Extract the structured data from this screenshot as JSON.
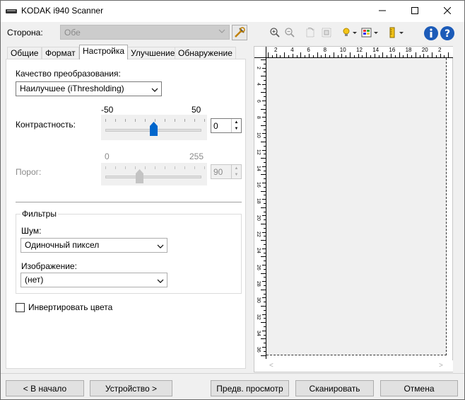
{
  "window": {
    "title": "KODAK i940 Scanner",
    "minimize": "—",
    "maximize": "☐",
    "close": "✕"
  },
  "side": {
    "label": "Сторона:",
    "value": "Обе"
  },
  "tabs": [
    {
      "label": "Общие"
    },
    {
      "label": "Формат"
    },
    {
      "label": "Настройка"
    },
    {
      "label": "Улучшение"
    },
    {
      "label": "Обнаружение"
    }
  ],
  "settings": {
    "conversion_quality_label": "Качество преобразования:",
    "conversion_quality_value": "Наилучшее (iThresholding)",
    "contrast": {
      "label": "Контрастность:",
      "min_label": "-50",
      "max_label": "50",
      "min": -50,
      "max": 50,
      "value": 0,
      "value_text": "0"
    },
    "threshold": {
      "label": "Порог:",
      "min_label": "0",
      "max_label": "255",
      "min": 0,
      "max": 255,
      "value": 90,
      "value_text": "90"
    },
    "filters": {
      "title": "Фильтры",
      "noise_label": "Шум:",
      "noise_value": "Одиночный пиксел",
      "image_label": "Изображение:",
      "image_value": "(нет)"
    },
    "invert_label": "Инвертировать цвета",
    "invert_checked": false
  },
  "ruler": {
    "top_labels": [
      "2",
      "4",
      "6",
      "8",
      "10",
      "12",
      "14",
      "16",
      "18",
      "20",
      "2"
    ],
    "left_labels": [
      "2",
      "4",
      "6",
      "8",
      "10",
      "12",
      "14",
      "16",
      "18",
      "20",
      "22",
      "24",
      "26",
      "28",
      "30",
      "32",
      "34",
      "36"
    ]
  },
  "buttons": {
    "home": "< В начало",
    "device": "Устройство >",
    "preview": "Предв. просмотр",
    "scan": "Сканировать",
    "cancel": "Отмена"
  },
  "colors": {
    "accent": "#0066cc",
    "info_blue": "#1c5bb8"
  }
}
